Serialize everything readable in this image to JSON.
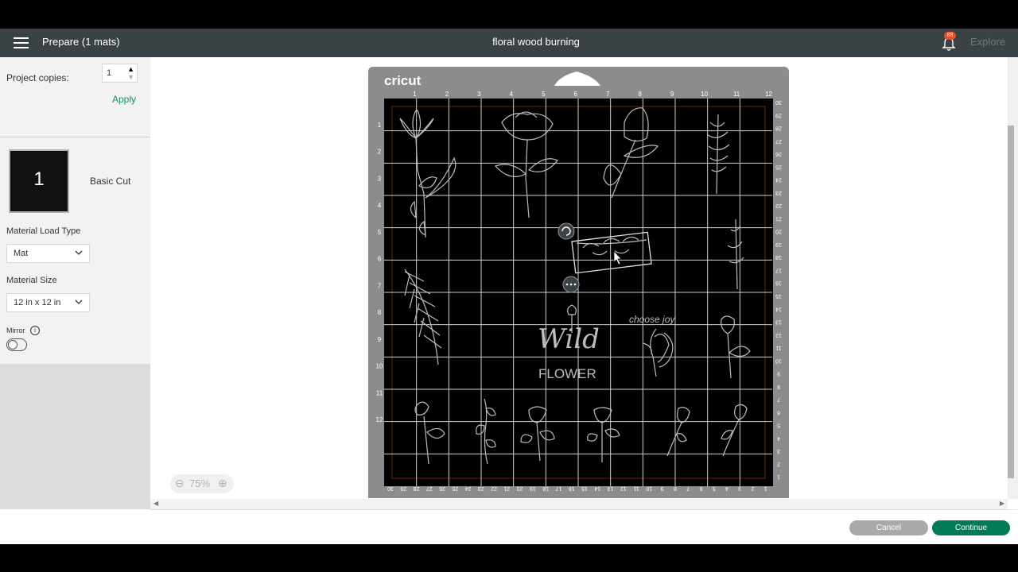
{
  "header": {
    "title": "Prepare (1 mats)",
    "project_name": "floral wood burning",
    "notification_count": "88",
    "explore_label": "Explore"
  },
  "sidebar": {
    "copies_label": "Project copies:",
    "copies_value": "1",
    "apply_label": "Apply",
    "mat_number": "1",
    "mat_name": "Basic Cut",
    "material_load_type_label": "Material Load Type",
    "material_load_type_value": "Mat",
    "material_size_label": "Material Size",
    "material_size_value": "12 in x 12 in",
    "mirror_label": "Mirror",
    "mirror_on": false
  },
  "mat": {
    "brand": "cricut",
    "top_ruler": [
      "1",
      "2",
      "3",
      "4",
      "5",
      "6",
      "7",
      "8",
      "9",
      "10",
      "11",
      "12"
    ],
    "left_ruler": [
      "1",
      "2",
      "3",
      "4",
      "5",
      "6",
      "7",
      "8",
      "9",
      "10",
      "11",
      "12"
    ],
    "right_ruler": [
      "30",
      "29",
      "28",
      "27",
      "26",
      "25",
      "24",
      "23",
      "22",
      "21",
      "20",
      "19",
      "18",
      "17",
      "16",
      "15",
      "14",
      "13",
      "12",
      "11",
      "10",
      "9",
      "8",
      "7",
      "6",
      "5",
      "4",
      "3",
      "2",
      "1"
    ],
    "bottom_ruler": [
      "30",
      "29",
      "28",
      "27",
      "26",
      "25",
      "24",
      "23",
      "22",
      "21",
      "20",
      "19",
      "18",
      "17",
      "16",
      "15",
      "14",
      "13",
      "12",
      "11",
      "10",
      "9",
      "8",
      "7",
      "6",
      "5",
      "4",
      "3",
      "2",
      "1"
    ],
    "design_text_1": "Wild",
    "design_text_2": "FLOWER",
    "design_text_3": "choose joy"
  },
  "canvas": {
    "zoom_label": "75%"
  },
  "footer": {
    "cancel_label": "Cancel",
    "continue_label": "Continue"
  },
  "colors": {
    "topbar": "#3b4246",
    "accent_green": "#007a57",
    "apply_green": "#1e8c68",
    "mat_gray": "#8c8c8c",
    "badge": "#e5502a"
  }
}
